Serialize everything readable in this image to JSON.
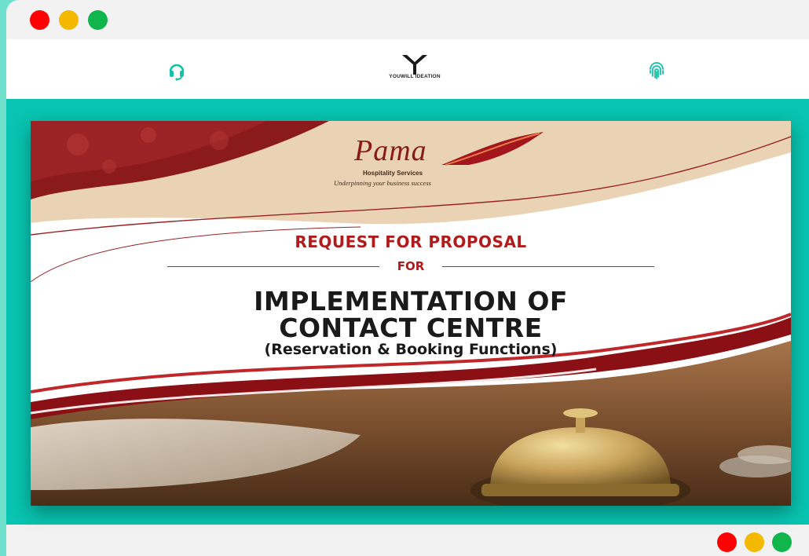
{
  "window": {
    "controls": [
      "close",
      "minimize",
      "maximize"
    ]
  },
  "navbar": {
    "left_icon": "headset-icon",
    "logo_text": "YOUWILL IDEATION",
    "right_icon": "fingerprint-icon"
  },
  "slide": {
    "brand": {
      "name": "Pama",
      "subtitle": "Hospitality Services",
      "tagline": "Underpinning your business success"
    },
    "title": "REQUEST FOR PROPOSAL",
    "for_label": "FOR",
    "main_line1": "IMPLEMENTATION OF",
    "main_line2": "CONTACT CENTRE",
    "subtitle": "(Reservation & Booking Functions)"
  },
  "colors": {
    "accent": "#08c4b0",
    "brand_red": "#b11b1b",
    "dark_red": "#7a0f12"
  }
}
